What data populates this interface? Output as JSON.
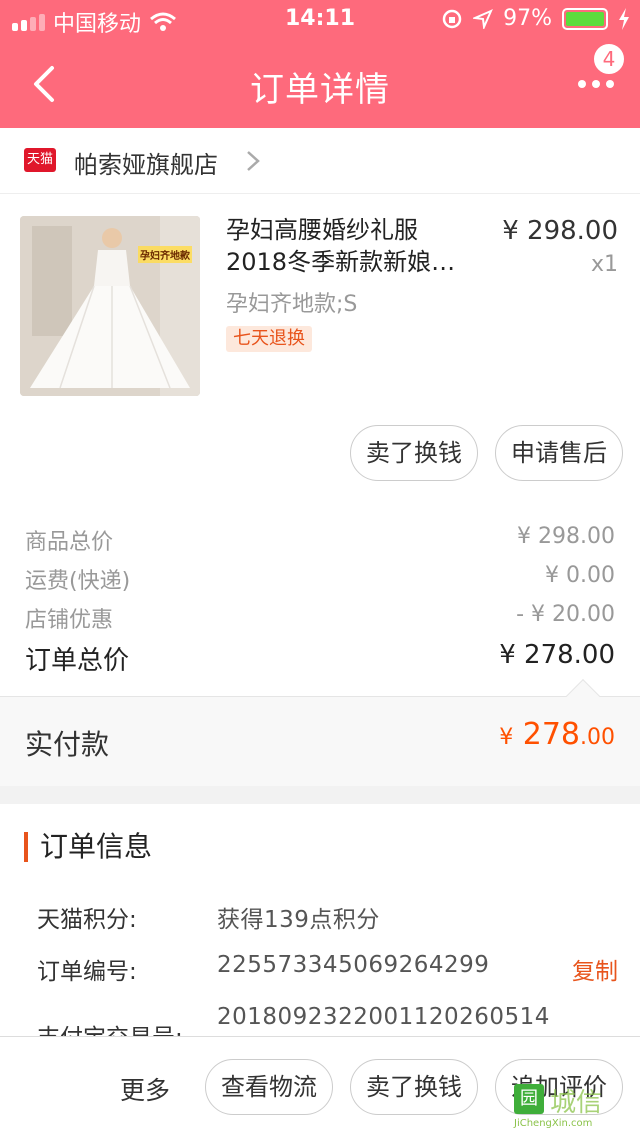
{
  "status_bar": {
    "carrier": "中国移动",
    "time": "14:11",
    "battery": "97%"
  },
  "nav": {
    "title": "订单详情",
    "badge": "4"
  },
  "store": {
    "logo_text": "天猫",
    "name": "帕索娅旗舰店"
  },
  "product": {
    "title_line1": "孕妇高腰婚纱礼服",
    "title_line2": "2018冬季新款新娘…",
    "price": "¥ 298.00",
    "quantity": "x1",
    "sku": "孕妇齐地款;S",
    "tag": "七天退换",
    "image_label": "孕妇齐地款",
    "actions": [
      "卖了换钱",
      "申请售后"
    ]
  },
  "prices": [
    {
      "label": "商品总价",
      "value": "¥ 298.00"
    },
    {
      "label": "运费(快递)",
      "value": "¥ 0.00"
    },
    {
      "label": "店铺优惠",
      "value": "- ¥ 20.00"
    }
  ],
  "order_total": {
    "label": "订单总价",
    "value": "¥ 278.00"
  },
  "paid": {
    "label": "实付款",
    "currency": "¥",
    "integer": "278",
    "decimal": ".00"
  },
  "order_info": {
    "heading": "订单信息",
    "rows": [
      {
        "key": "天猫积分:",
        "value": "获得139点积分"
      },
      {
        "key": "订单编号:",
        "value": "225573345069264299",
        "action": "复制"
      },
      {
        "key": "支付宝交易号:",
        "value": "2018092322001120260514"
      }
    ]
  },
  "bottom_bar": {
    "more": "更多",
    "buttons": [
      "查看物流",
      "卖了换钱",
      "追加评价"
    ]
  },
  "watermark": {
    "mark": "园",
    "text": "城信",
    "url": "JiChengXin.com"
  },
  "colors": {
    "brand_pink": "#fe6a7c",
    "accent_orange": "#ff5000",
    "tmall_red": "#e0172b"
  }
}
